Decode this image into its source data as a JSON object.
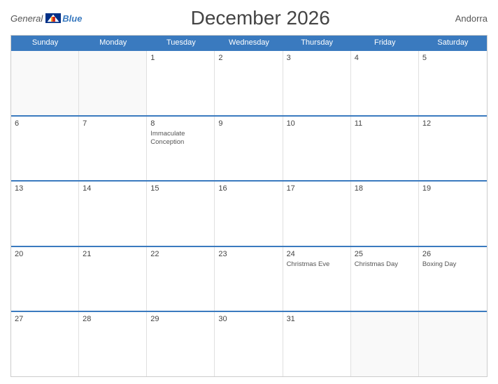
{
  "header": {
    "title": "December 2026",
    "country": "Andorra",
    "logo": {
      "general": "General",
      "blue": "Blue"
    }
  },
  "calendar": {
    "weekdays": [
      "Sunday",
      "Monday",
      "Tuesday",
      "Wednesday",
      "Thursday",
      "Friday",
      "Saturday"
    ],
    "rows": [
      [
        {
          "day": "",
          "empty": true
        },
        {
          "day": "",
          "empty": true
        },
        {
          "day": "1",
          "events": []
        },
        {
          "day": "2",
          "events": []
        },
        {
          "day": "3",
          "events": []
        },
        {
          "day": "4",
          "events": []
        },
        {
          "day": "5",
          "events": []
        }
      ],
      [
        {
          "day": "6",
          "events": []
        },
        {
          "day": "7",
          "events": []
        },
        {
          "day": "8",
          "events": [
            "Immaculate Conception"
          ]
        },
        {
          "day": "9",
          "events": []
        },
        {
          "day": "10",
          "events": []
        },
        {
          "day": "11",
          "events": []
        },
        {
          "day": "12",
          "events": []
        }
      ],
      [
        {
          "day": "13",
          "events": []
        },
        {
          "day": "14",
          "events": []
        },
        {
          "day": "15",
          "events": []
        },
        {
          "day": "16",
          "events": []
        },
        {
          "day": "17",
          "events": []
        },
        {
          "day": "18",
          "events": []
        },
        {
          "day": "19",
          "events": []
        }
      ],
      [
        {
          "day": "20",
          "events": []
        },
        {
          "day": "21",
          "events": []
        },
        {
          "day": "22",
          "events": []
        },
        {
          "day": "23",
          "events": []
        },
        {
          "day": "24",
          "events": [
            "Christmas Eve"
          ]
        },
        {
          "day": "25",
          "events": [
            "Christmas Day"
          ]
        },
        {
          "day": "26",
          "events": [
            "Boxing Day"
          ]
        }
      ],
      [
        {
          "day": "27",
          "events": []
        },
        {
          "day": "28",
          "events": []
        },
        {
          "day": "29",
          "events": []
        },
        {
          "day": "30",
          "events": []
        },
        {
          "day": "31",
          "events": []
        },
        {
          "day": "",
          "empty": true
        },
        {
          "day": "",
          "empty": true
        }
      ]
    ]
  }
}
